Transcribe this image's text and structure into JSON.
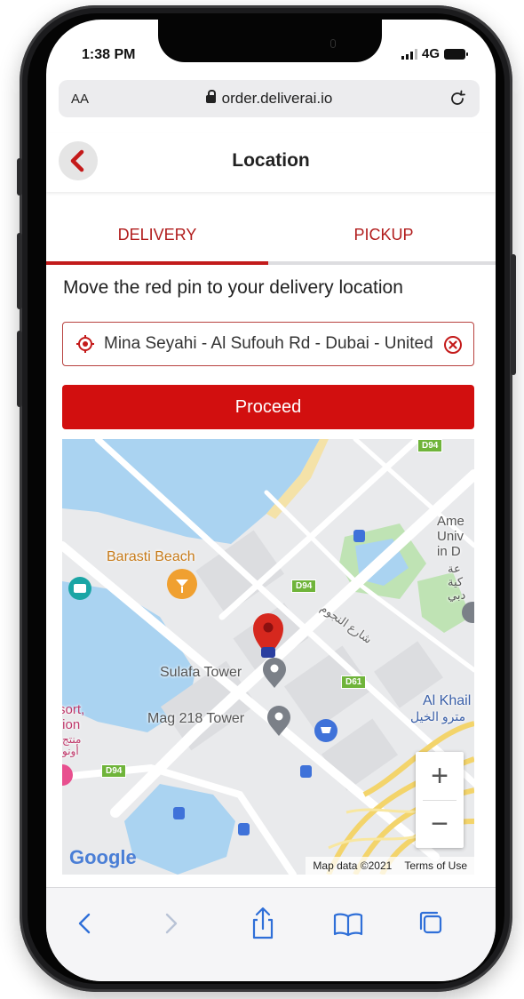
{
  "status": {
    "time": "1:38 PM",
    "network": "4G"
  },
  "browser": {
    "text_size_label": "AA",
    "url": "order.deliverai.io"
  },
  "header": {
    "title": "Location"
  },
  "tabs": [
    {
      "label": "DELIVERY",
      "active": true
    },
    {
      "label": "PICKUP",
      "active": false
    }
  ],
  "instruction": "Move the red pin to your delivery location",
  "search": {
    "value": "Mina Seyahi - Al Sufouh Rd - Dubai - United Arab Emirates"
  },
  "proceed_label": "Proceed",
  "map": {
    "labels": {
      "barasti": "Barasti Beach",
      "sulafa": "Sulafa Tower",
      "mag218": "Mag 218 Tower",
      "al_khail_en": "Al Khail",
      "al_khail_ar": "مترو الخيل",
      "american_univ": "Ame Univ in D",
      "arabic_univ": "عة كية دبي",
      "street_ar": "شارع النجوم",
      "resort": "sort, tion",
      "resort_ar": "منتج أونو"
    },
    "roads": [
      "D94",
      "D94",
      "D61",
      "D94"
    ],
    "google": "Google",
    "attribution": "Map data ©2021",
    "terms": "Terms of Use",
    "zoom_in": "+",
    "zoom_out": "−"
  },
  "colors": {
    "accent": "#d20f0f",
    "tab_text": "#b11c1c",
    "water": "#a9d2f0"
  }
}
